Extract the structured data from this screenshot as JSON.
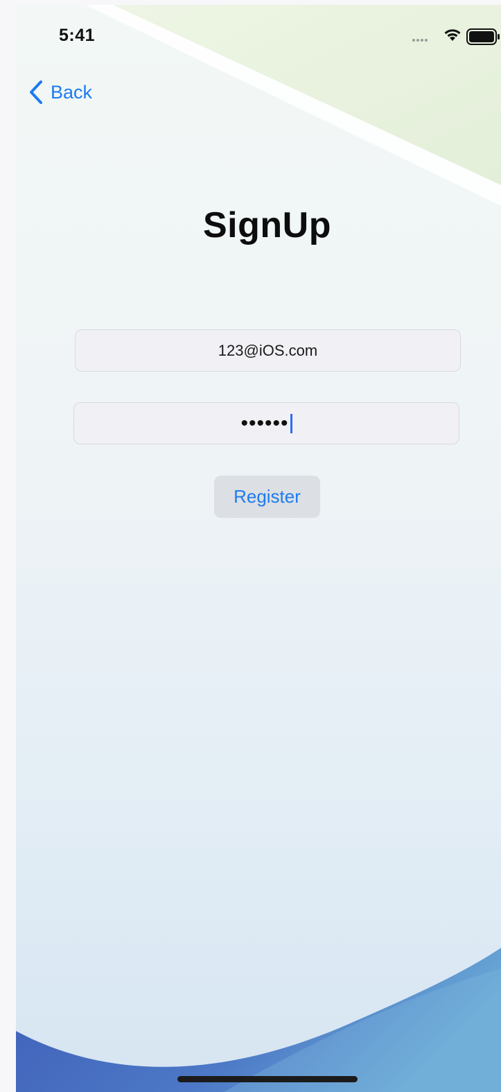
{
  "status_bar": {
    "time": "5:41",
    "icons": [
      "signal-dots-icon",
      "wifi-icon",
      "battery-icon"
    ]
  },
  "navigation": {
    "back_label": "Back",
    "back_icon": "chevron-left-icon"
  },
  "page": {
    "title": "SignUp"
  },
  "form": {
    "email_value": "123@iOS.com",
    "password_masked": "••••••",
    "register_label": "Register"
  },
  "colors": {
    "accent": "#1d7bf0",
    "field_background": "#f1f1f5",
    "button_background": "#dcdfe3",
    "wave_blue": "#4a70c4",
    "corner_green": "#e8f2de"
  }
}
